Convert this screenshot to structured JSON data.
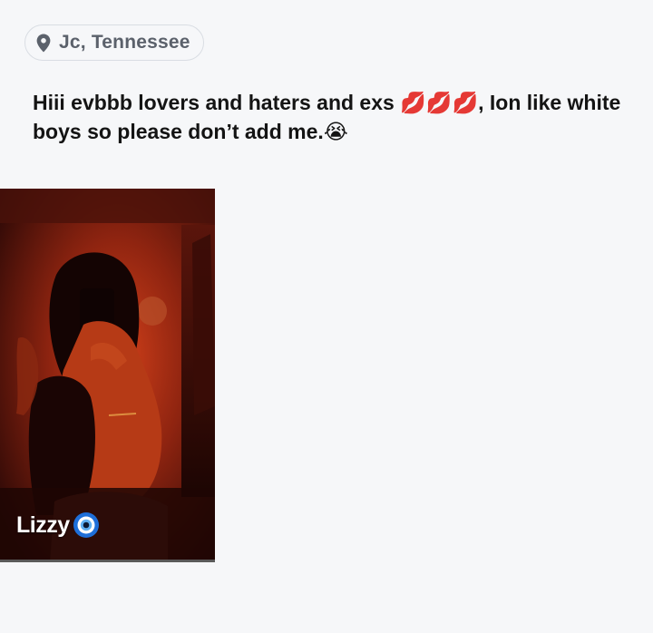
{
  "location": {
    "icon": "map-pin-icon",
    "text": "Jc, Tennessee"
  },
  "bio": {
    "text_part1": "Hiii evbbb lovers and haters and exs ",
    "lips_emoji": "💋💋💋",
    "text_part2": ", Ion like white boys so please don’t add me.",
    "crying_emoji": "😭"
  },
  "photo": {
    "caption_name": "Lizzy",
    "caption_icon": "nazar-eye-icon"
  },
  "colors": {
    "background": "#f6f7f9",
    "pill_border": "#d9dde3",
    "location_text": "#5b616b",
    "nazar_blue": "#1e6fd9"
  }
}
